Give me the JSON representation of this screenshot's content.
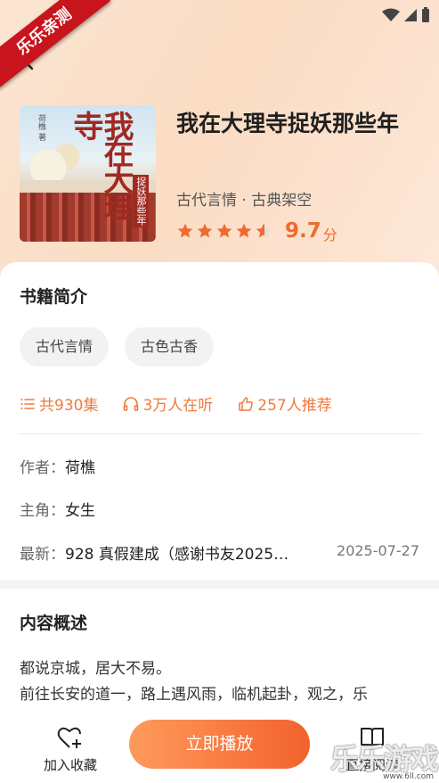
{
  "watermark": {
    "badge": "乐乐亲测",
    "corner": "乐乐游戏",
    "url": "www.6ll.com"
  },
  "header": {
    "back_icon": "chevron-left-icon"
  },
  "book": {
    "cover_title": "我在大理寺",
    "cover_subtitle": "捉妖那些年",
    "cover_author": "荷樵 著",
    "title": "我在大理寺捉妖那些年",
    "genre": "古代言情 · 古典架空",
    "rating_fraction": 0.9,
    "score": "9.7",
    "score_unit": "分",
    "accent_color": "#f06b2e"
  },
  "intro": {
    "title": "书籍简介",
    "tags": [
      "古代言情",
      "古色古香"
    ],
    "episodes": "共930集",
    "listeners": "3万人在听",
    "recommend": "257人推荐",
    "author_label": "作者：",
    "author": "荷樵",
    "role_label": "主角：",
    "role": "女生",
    "latest_label": "最新：",
    "latest": "928 真假建成（感谢书友2025…",
    "latest_date": "2025-07-27"
  },
  "summary": {
    "title": "内容概述",
    "line1": "都说京城，居大不易。",
    "line2": "前往长安的道一，路上遇风雨，临机起卦，观之，乐"
  },
  "bottom": {
    "favorite_label": "加入收藏",
    "play_label": "立即播放",
    "read_label": "直接阅读"
  }
}
